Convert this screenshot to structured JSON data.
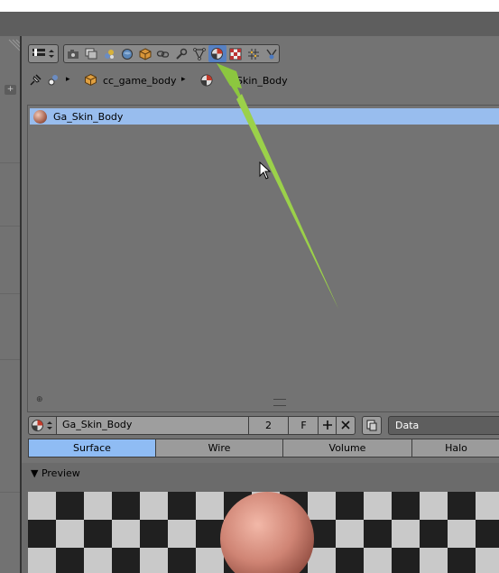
{
  "toolbar": {
    "tab_icons": [
      "render-tab",
      "render-layers-tab",
      "scene-tab",
      "world-tab",
      "object-tab",
      "constraints-tab",
      "modifiers-tab",
      "data-tab",
      "material-tab",
      "texture-tab",
      "particles-tab",
      "physics-tab"
    ],
    "active_tab": "material-tab"
  },
  "breadcrumb": {
    "object": "cc_game_body",
    "material": "Skin_Body"
  },
  "material_list": {
    "items": [
      "Ga_Skin_Body"
    ]
  },
  "material_row": {
    "name": "Ga_Skin_Body",
    "users": "2",
    "fake_user": "F",
    "link": "Data"
  },
  "material_types": [
    "Surface",
    "Wire",
    "Volume",
    "Halo"
  ],
  "active_type": "Surface",
  "preview": {
    "header": "▼ Preview"
  },
  "colors": {
    "active_tab": "#5680c2",
    "selected_row": "#98bdee",
    "arrow": "#8cc63f"
  }
}
